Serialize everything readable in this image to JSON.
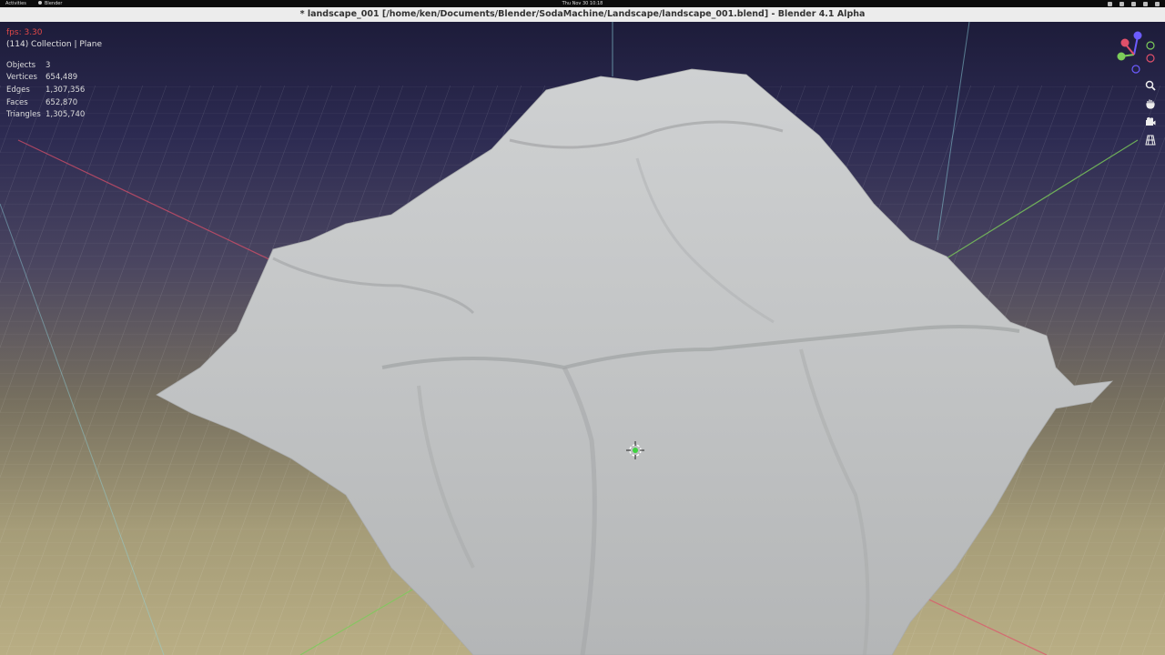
{
  "system_bar": {
    "activities": "Activities",
    "app_name": "Blender",
    "clock": "Thu Nov 30  10:18"
  },
  "window": {
    "title": "* landscape_001 [/home/ken/Documents/Blender/SodaMachine/Landscape/landscape_001.blend] - Blender 4.1 Alpha"
  },
  "viewport": {
    "fps": "fps: 3.30",
    "collection": "(114) Collection | Plane",
    "stats": [
      {
        "label": "Objects",
        "value": "3"
      },
      {
        "label": "Vertices",
        "value": "654,489"
      },
      {
        "label": "Edges",
        "value": "1,307,356"
      },
      {
        "label": "Faces",
        "value": "652,870"
      },
      {
        "label": "Triangles",
        "value": "1,305,740"
      }
    ],
    "nav_icons": [
      "zoom-icon",
      "hand-pan-icon",
      "camera-icon",
      "grid-icon"
    ],
    "colors": {
      "sky_top": "#1d1c3a",
      "ground": "#b9ae84",
      "x_axis": "#e0506a",
      "y_axis": "#7ccc5a",
      "mesh": "#c8cacb",
      "fps_red": "#e04848"
    }
  }
}
